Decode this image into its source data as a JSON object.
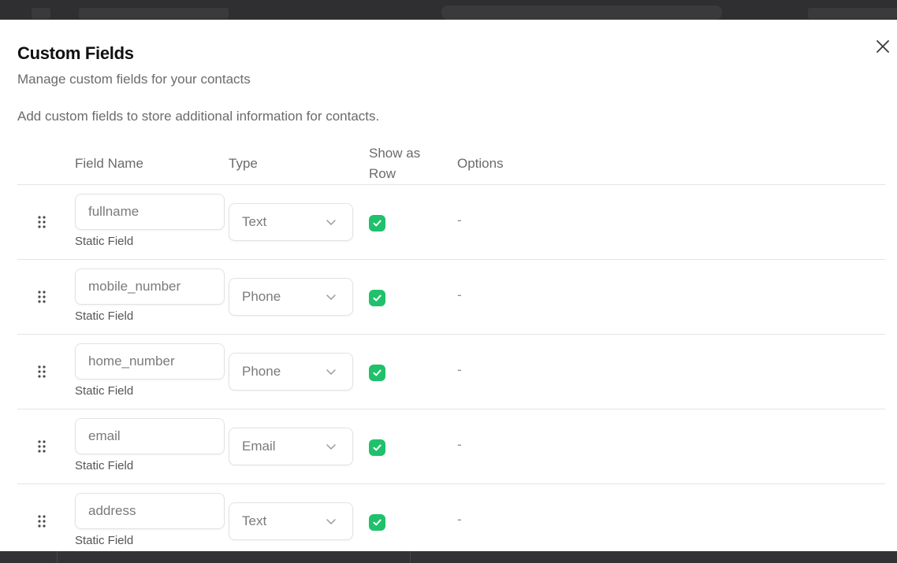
{
  "modal": {
    "title": "Custom Fields",
    "subtitle": "Manage custom fields for your contacts",
    "description": "Add custom fields to store additional information for contacts.",
    "close_icon": "close-icon"
  },
  "table": {
    "headers": {
      "field_name": "Field Name",
      "type": "Type",
      "show_as_row": "Show as Row",
      "options": "Options"
    },
    "rows": [
      {
        "name": "fullname",
        "label": "Static Field",
        "type": "Text",
        "show_as_row": true,
        "options": "-"
      },
      {
        "name": "mobile_number",
        "label": "Static Field",
        "type": "Phone",
        "show_as_row": true,
        "options": "-"
      },
      {
        "name": "home_number",
        "label": "Static Field",
        "type": "Phone",
        "show_as_row": true,
        "options": "-"
      },
      {
        "name": "email",
        "label": "Static Field",
        "type": "Email",
        "show_as_row": true,
        "options": "-"
      },
      {
        "name": "address",
        "label": "Static Field",
        "type": "Text",
        "show_as_row": true,
        "options": "-"
      }
    ]
  },
  "colors": {
    "checkbox_checked": "#1fc16b",
    "overlay": "#3b3b3d"
  }
}
